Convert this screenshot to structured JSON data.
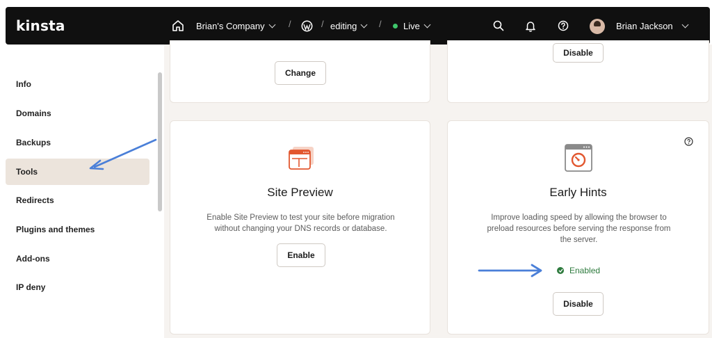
{
  "header": {
    "logo": "kinsta",
    "company": "Brian's Company",
    "environment": "editing",
    "status": "Live",
    "user_name": "Brian Jackson",
    "separator": "/"
  },
  "sidebar": {
    "items": [
      {
        "label": "Info"
      },
      {
        "label": "Domains"
      },
      {
        "label": "Backups"
      },
      {
        "label": "Tools",
        "active": true
      },
      {
        "label": "Redirects"
      },
      {
        "label": "Plugins and themes"
      },
      {
        "label": "Add-ons"
      },
      {
        "label": "IP deny"
      }
    ]
  },
  "cards": {
    "top_left": {
      "button": "Change"
    },
    "top_right": {
      "button": "Disable"
    },
    "site_preview": {
      "title": "Site Preview",
      "description_1": "Enable Site Preview to test your site before migration",
      "description_2": "without changing your DNS records or database.",
      "button": "Enable"
    },
    "early_hints": {
      "title": "Early Hints",
      "description_1": "Improve loading speed by allowing the browser to",
      "description_2": "preload resources before serving the response from",
      "description_3": "the server.",
      "status": "Enabled",
      "button": "Disable"
    }
  },
  "icons": [
    "home-icon",
    "wordpress-icon",
    "search-icon",
    "bell-icon",
    "help-icon",
    "site-preview-icon",
    "early-hints-icon",
    "check-icon"
  ],
  "colors": {
    "topbar": "#101010",
    "content_bg": "#f6f3f0",
    "active_item": "#ece4dc",
    "accent_orange": "#e2572f",
    "enabled_green": "#2d7a3d",
    "annotation_arrow": "#4a7fd8"
  }
}
